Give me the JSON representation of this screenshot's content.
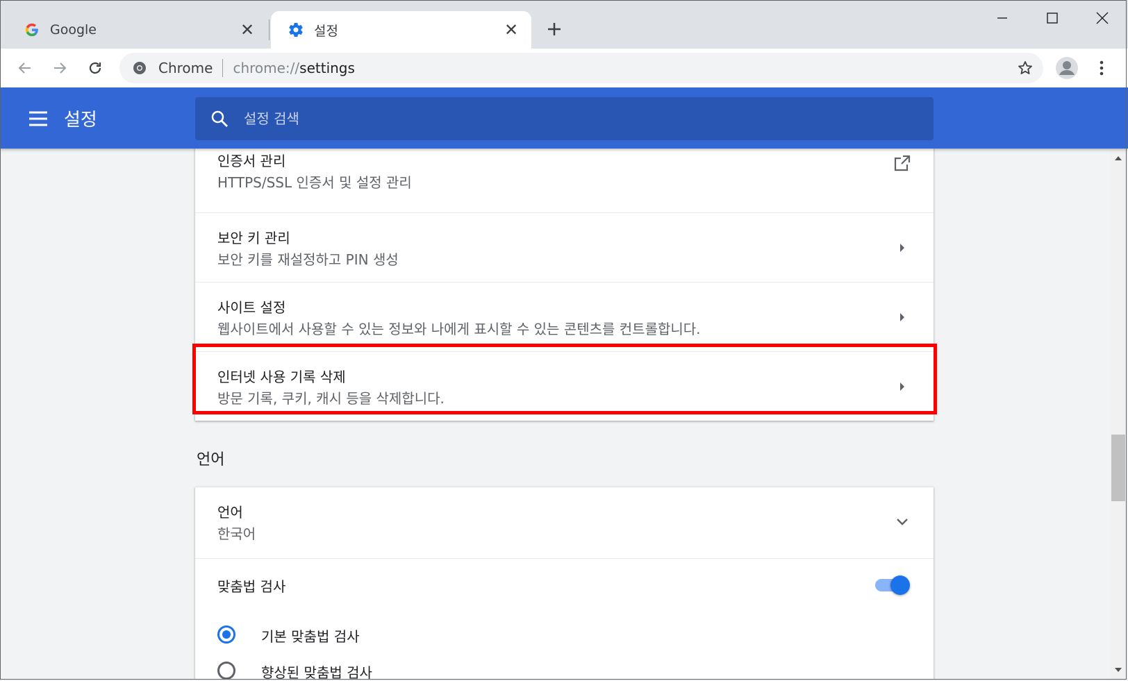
{
  "tabs": [
    {
      "label": "Google",
      "icon": "google-g-icon",
      "active": false
    },
    {
      "label": "설정",
      "icon": "gear-icon",
      "active": true
    }
  ],
  "omnibox": {
    "site_label": "Chrome",
    "url_scheme": "chrome://",
    "url_path": "settings"
  },
  "header": {
    "title": "설정",
    "search_placeholder": "설정 검색"
  },
  "privacy_rows": [
    {
      "title": "인증서 관리",
      "subtitle": "HTTPS/SSL 인증서 및 설정 관리",
      "action_icon": "open-in-new-icon"
    },
    {
      "title": "보안 키 관리",
      "subtitle": "보안 키를 재설정하고 PIN 생성",
      "action_icon": "chevron-right-icon"
    },
    {
      "title": "사이트 설정",
      "subtitle": "웹사이트에서 사용할 수 있는 정보와 나에게 표시할 수 있는 콘텐츠를 컨트롤합니다.",
      "action_icon": "chevron-right-icon"
    },
    {
      "title": "인터넷 사용 기록 삭제",
      "subtitle": "방문 기록, 쿠키, 캐시 등을 삭제합니다.",
      "action_icon": "chevron-right-icon"
    }
  ],
  "language_section": {
    "title": "언어",
    "language_row": {
      "title": "언어",
      "value": "한국어"
    },
    "spellcheck": {
      "title": "맞춤법 검사",
      "enabled": true,
      "options": [
        {
          "label": "기본 맞춤법 검사",
          "selected": true
        },
        {
          "label": "향상된 맞춤법 검사",
          "selected": false
        }
      ]
    }
  },
  "colors": {
    "header_blue": "#3367d6",
    "search_blue": "#2a56b3",
    "accent": "#1a73e8",
    "highlight_red": "#ff0000"
  }
}
